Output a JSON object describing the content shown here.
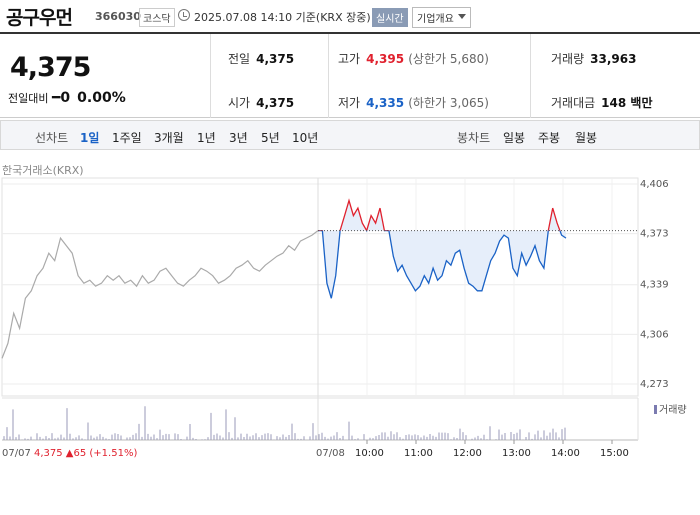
{
  "header": {
    "name": "공구우먼",
    "code": "366030",
    "market": "코스닥",
    "time": "2025.07.08 14:10 기준(KRX 장중)",
    "realtime": "실시간",
    "company_info": "기업개요"
  },
  "summary": {
    "price": "4,375",
    "change_label": "전일대비",
    "change_value": "0",
    "change_pct": "0.00%",
    "prev_label": "전일",
    "prev": "4,375",
    "open_label": "시가",
    "open": "4,375",
    "high_label": "고가",
    "high": "4,395",
    "upper_limit": "(상한가 5,680)",
    "low_label": "저가",
    "low": "4,335",
    "lower_limit": "(하한가 3,065)",
    "volume_label": "거래량",
    "volume": "33,963",
    "amount_label": "거래대금",
    "amount": "148 백만"
  },
  "tabs": {
    "line_label": "선차트",
    "line_items": [
      "1일",
      "1주일",
      "3개월",
      "1년",
      "3년",
      "5년",
      "10년"
    ],
    "active": "1일",
    "candle_label": "봉차트",
    "candle_items": [
      "일봉",
      "주봉",
      "월봉"
    ]
  },
  "source": "한국거래소(KRX)",
  "colors": {
    "up": "#e0212e",
    "down": "#1a62c6",
    "prev": "#aaaaaa",
    "fill": "#e3ecfa"
  },
  "chart_data": {
    "type": "line",
    "y_ticks": [
      4406,
      4373,
      4339,
      4306,
      4273
    ],
    "ylim": [
      4265,
      4410
    ],
    "reference": 4375,
    "x_ticks": [
      "07/08",
      "10:00",
      "11:00",
      "12:00",
      "13:00",
      "14:00",
      "15:00"
    ],
    "prev_day_label": "07/07",
    "prev_day_close": "4,375",
    "prev_day_change": "65",
    "prev_day_pct": "(+1.51%)",
    "prev_day_series": [
      4290,
      4300,
      4320,
      4310,
      4330,
      4335,
      4345,
      4350,
      4360,
      4355,
      4370,
      4365,
      4360,
      4345,
      4340,
      4342,
      4338,
      4340,
      4345,
      4342,
      4345,
      4340,
      4342,
      4338,
      4345,
      4340,
      4342,
      4348,
      4350,
      4345,
      4340,
      4338,
      4342,
      4345,
      4350,
      4348,
      4345,
      4340,
      4342,
      4345,
      4350,
      4352,
      4355,
      4350,
      4348,
      4352,
      4355,
      4358,
      4360,
      4365,
      4362,
      4368,
      4370,
      4372,
      4375
    ],
    "today_series": [
      4375,
      4375,
      4340,
      4330,
      4345,
      4375,
      4385,
      4395,
      4385,
      4390,
      4380,
      4375,
      4385,
      4380,
      4390,
      4375,
      4375,
      4358,
      4348,
      4352,
      4345,
      4340,
      4335,
      4338,
      4345,
      4340,
      4350,
      4342,
      4345,
      4355,
      4352,
      4360,
      4362,
      4350,
      4340,
      4338,
      4335,
      4335,
      4345,
      4355,
      4360,
      4368,
      4372,
      4370,
      4350,
      4345,
      4360,
      4352,
      4358,
      4365,
      4355,
      4350,
      4375,
      4390,
      4380,
      4372,
      4370
    ],
    "legend": "거래량"
  }
}
